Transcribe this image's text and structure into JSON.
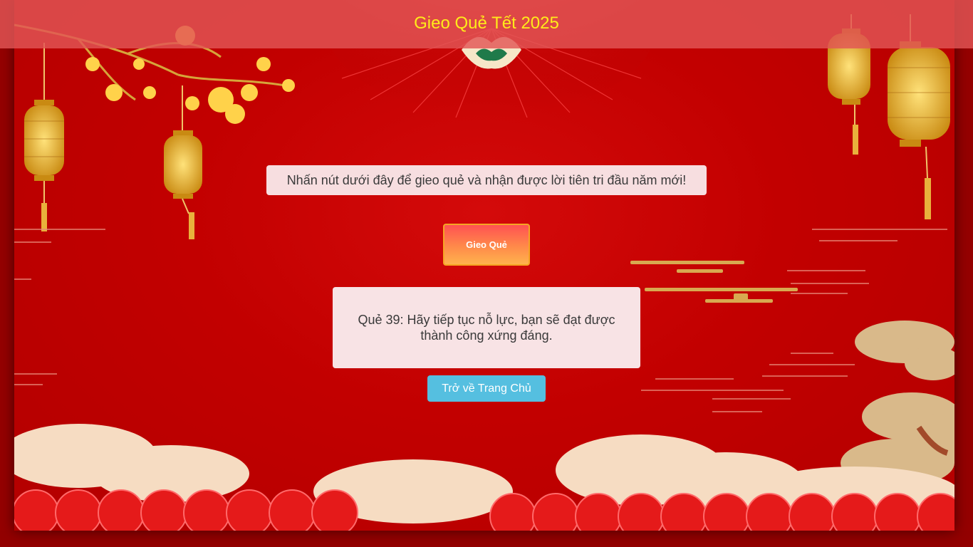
{
  "header": {
    "title": "Gieo Quẻ Tết 2025"
  },
  "instruction": {
    "text": "Nhấn nút dưới đây để gieo quẻ và nhận được lời tiên tri đầu năm mới!"
  },
  "draw_button": {
    "label": "Gieo Quẻ"
  },
  "result": {
    "text": "Quẻ 39: Hãy tiếp tục nỗ lực, bạn sẽ đạt được thành công xứng đáng."
  },
  "home_button": {
    "label": "Trở về Trang Chủ"
  },
  "colors": {
    "background": "#c20000",
    "header_bar": "#e25656",
    "title": "#ffeb1a",
    "home_button": "#55bfe0",
    "draw_button_start": "#ff5252",
    "draw_button_end": "#ffb24d"
  }
}
